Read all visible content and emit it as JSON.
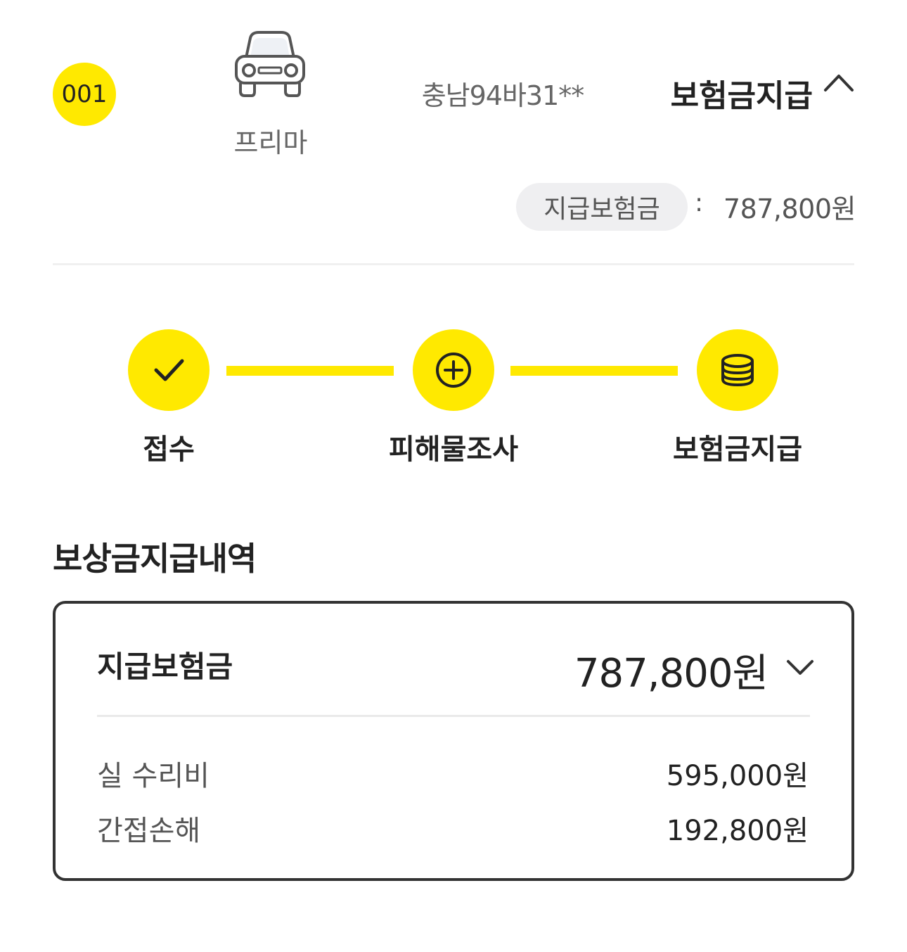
{
  "header": {
    "number": "001",
    "car_icon": "car-icon",
    "car_name": "프리마",
    "plate": "충남94바31**",
    "status": "보험금지급",
    "toggle_icon": "chevron-up-icon",
    "paid_label": "지급보험금",
    "colon": ":",
    "paid_amount": "787,800원"
  },
  "steps": [
    {
      "label": "접수",
      "icon": "check-icon"
    },
    {
      "label": "피해물조사",
      "icon": "plus-circle-icon"
    },
    {
      "label": "보험금지급",
      "icon": "coins-icon"
    }
  ],
  "colors": {
    "accent": "#FFE900",
    "pill_bg": "#EFEFF1",
    "text": "#222222",
    "muted": "#666666"
  },
  "history": {
    "title": "보상금지급내역",
    "summary_label": "지급보험금",
    "summary_amount": "787,800원",
    "toggle_icon": "chevron-down-icon",
    "rows": [
      {
        "label": "실 수리비",
        "value": "595,000원"
      },
      {
        "label": "간접손해",
        "value": "192,800원"
      }
    ]
  }
}
